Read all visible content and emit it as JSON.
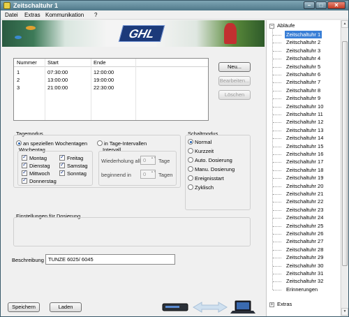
{
  "window": {
    "title": "Zeitschaltuhr 1"
  },
  "menu": [
    "Datei",
    "Extras",
    "Kommunikation",
    "?"
  ],
  "banner": {
    "logo": "GHL"
  },
  "schedule": {
    "headers": [
      "Nummer",
      "Start",
      "Ende"
    ],
    "rows": [
      {
        "num": "1",
        "start": "07:30:00",
        "end": "12:00:00"
      },
      {
        "num": "2",
        "start": "13:00:00",
        "end": "19:00:00"
      },
      {
        "num": "3",
        "start": "21:00:00",
        "end": "22:30:00"
      }
    ]
  },
  "actions": {
    "new": "Neu...",
    "edit": "Bearbeiten...",
    "delete": "Löschen"
  },
  "tagemodus": {
    "title": "Tagemodus",
    "opt_weekdays": "an speziellen Wochentagen",
    "opt_interval": "in Tage-Intervallen",
    "wochentag_label": "Wochentag",
    "days": [
      {
        "label": "Montag",
        "checked": true
      },
      {
        "label": "Dienstag",
        "checked": true
      },
      {
        "label": "Mittwoch",
        "checked": true
      },
      {
        "label": "Donnerstag",
        "checked": true
      },
      {
        "label": "Freitag",
        "checked": true
      },
      {
        "label": "Samstag",
        "checked": true
      },
      {
        "label": "Sonntag",
        "checked": true
      }
    ],
    "interval_label": "Intervall",
    "repeat_label": "Wiederholung alle",
    "repeat_value": "0",
    "repeat_unit": "Tage",
    "begin_label": "beginnend in",
    "begin_value": "0",
    "begin_unit": "Tagen"
  },
  "schaltmodus": {
    "title": "Schaltmodus",
    "options": [
      {
        "label": "Normal",
        "selected": true
      },
      {
        "label": "Kurzzeit",
        "selected": false
      },
      {
        "label": "Auto. Dosierung",
        "selected": false
      },
      {
        "label": "Manu. Dosierung",
        "selected": false
      },
      {
        "label": "Ereignisstart",
        "selected": false
      },
      {
        "label": "Zyklisch",
        "selected": false
      }
    ]
  },
  "dosierung": {
    "title": "Einstellungen für Dosierung"
  },
  "beschreibung": {
    "label": "Beschreibung",
    "value": "TUNZE 6025/ 6045"
  },
  "footer": {
    "save": "Speichern",
    "load": "Laden"
  },
  "tree": {
    "root": "Abläufe",
    "items": [
      "Zeitschaltuhr 1",
      "Zeitschaltuhr 2",
      "Zeitschaltuhr 3",
      "Zeitschaltuhr 4",
      "Zeitschaltuhr 5",
      "Zeitschaltuhr 6",
      "Zeitschaltuhr 7",
      "Zeitschaltuhr 8",
      "Zeitschaltuhr 9",
      "Zeitschaltuhr 10",
      "Zeitschaltuhr 11",
      "Zeitschaltuhr 12",
      "Zeitschaltuhr 13",
      "Zeitschaltuhr 14",
      "Zeitschaltuhr 15",
      "Zeitschaltuhr 16",
      "Zeitschaltuhr 17",
      "Zeitschaltuhr 18",
      "Zeitschaltuhr 19",
      "Zeitschaltuhr 20",
      "Zeitschaltuhr 21",
      "Zeitschaltuhr 22",
      "Zeitschaltuhr 23",
      "Zeitschaltuhr 24",
      "Zeitschaltuhr 25",
      "Zeitschaltuhr 26",
      "Zeitschaltuhr 27",
      "Zeitschaltuhr 28",
      "Zeitschaltuhr 29",
      "Zeitschaltuhr 30",
      "Zeitschaltuhr 31",
      "Zeitschaltuhr 32",
      "Erinnerungen"
    ],
    "selected_index": 0,
    "second_root": "Extras"
  },
  "colors": {
    "selection": "#3a7fd6",
    "titlebar": "#5f8898"
  }
}
